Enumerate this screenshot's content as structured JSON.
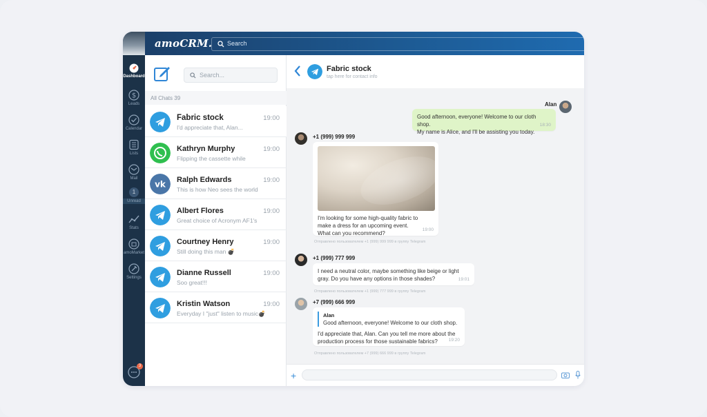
{
  "app": {
    "logo": "amoCRM.",
    "top_search_placeholder": "Search"
  },
  "rail": {
    "items": [
      {
        "label": "Dashboard",
        "icon": "dashboard-icon",
        "active": true
      },
      {
        "label": "Leads",
        "icon": "dollar-icon"
      },
      {
        "label": "Calendar",
        "icon": "check-icon"
      },
      {
        "label": "Lists",
        "icon": "list-icon"
      },
      {
        "label": "Mail",
        "icon": "mail-icon"
      },
      {
        "label": "Unread",
        "icon": "unread-count",
        "count": "1"
      },
      {
        "label": "Stats",
        "icon": "stats-icon"
      },
      {
        "label": "amoMarket",
        "icon": "market-icon"
      },
      {
        "label": "Settings",
        "icon": "settings-icon"
      }
    ],
    "chat_badge": "3"
  },
  "list": {
    "search_placeholder": "Search...",
    "all_chats_label": "All Chats",
    "all_chats_count": "39",
    "chats": [
      {
        "name": "Fabric stock",
        "preview": "I'd appreciate that, Alan...",
        "time": "19:00",
        "channel": "telegram"
      },
      {
        "name": "Kathryn Murphy",
        "preview": "Flipping the cassette while",
        "time": "19:00",
        "channel": "whatsapp"
      },
      {
        "name": "Ralph Edwards",
        "preview": "This is how Neo sees the world",
        "time": "19:00",
        "channel": "vk"
      },
      {
        "name": "Albert Flores",
        "preview": "Great choice of Acronym AF1's",
        "time": "19:00",
        "channel": "telegram"
      },
      {
        "name": "Courtney Henry",
        "preview": "Still doing this man 💣",
        "time": "19:00",
        "channel": "telegram"
      },
      {
        "name": "Dianne Russell",
        "preview": "Soo great!!!",
        "time": "19:00",
        "channel": "telegram"
      },
      {
        "name": "Kristin Watson",
        "preview": "Everyday I \"just\" listen to music💣",
        "time": "19:00",
        "channel": "telegram"
      }
    ]
  },
  "conversation": {
    "title": "Fabric stock",
    "subtitle": "tap here for contact info",
    "messages": {
      "m1": {
        "author": "Alan",
        "text1": "Good afternoon, everyone! Welcome to our cloth shop.",
        "text2": "My name is Alice, and I'll be assisting you today.",
        "time": "18:30"
      },
      "m2": {
        "author": "+1 (999) 999 999",
        "text1": "I'm looking for some high-quality fabric to",
        "text2": "make a dress for an upcoming event.",
        "text3": "What can you recommend?",
        "time": "19:00",
        "note": "Отправлено пользователем +1 (999) 999 999 в группу Telegram"
      },
      "m3": {
        "author": "+1 (999) 777 999",
        "text1": "I need a neutral color, maybe something like beige or light",
        "text2": "gray. Do you have any options in those shades?",
        "time": "19:01",
        "note": "Отправлено пользователем +1 (999) 777 999 в группу Telegram"
      },
      "m4": {
        "author": "+7 (999) 666 999",
        "quote_author": "Alan",
        "quote_text": "Good afternoon, everyone! Welcome to our cloth shop.",
        "text1": "I'd appreciate that, Alan. Can you tell me more about the",
        "text2": "production process for those sustainable fabrics?",
        "time": "19:20",
        "note": "Отправлено пользователем +7 (999) 666 999 в группу Telegram"
      }
    }
  },
  "colors": {
    "telegram": "#2f9ee0",
    "whatsapp": "#2fbf4f",
    "vk": "#4a76a8",
    "outgoing_bubble": "#dff4c8",
    "rail": "#1c3248"
  }
}
